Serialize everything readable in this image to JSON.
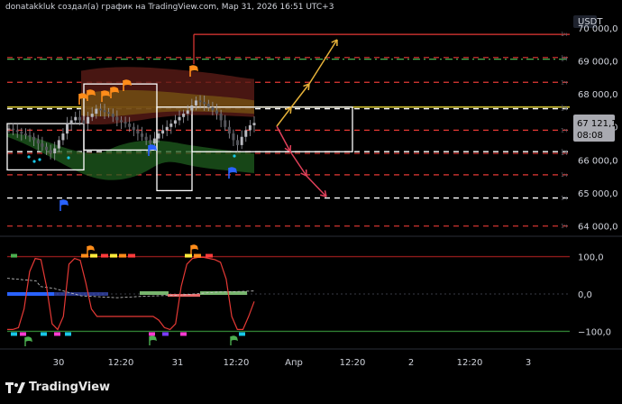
{
  "header": {
    "caption": "donatakkluk создал(а) график на TradingView.com, Мар 31, 2026 16:51 UTC+3"
  },
  "price_axis": {
    "currency": "USDT",
    "last_price": "67 121,1",
    "countdown": "08:08",
    "tick_labels": [
      "70 000,0",
      "69 000,0",
      "68 000,0",
      "67 000,0",
      "66 000,0",
      "65 000,0",
      "64 000,0"
    ],
    "line_tag": "1ч"
  },
  "oscillator_axis": {
    "tick_labels": [
      "100,0",
      "0,0",
      "−100,0"
    ]
  },
  "time_axis": {
    "tick_labels": [
      "30",
      "12:20",
      "31",
      "12:20",
      "Апр",
      "12:20",
      "2",
      "12:20",
      "3"
    ]
  },
  "footer": {
    "brand": "TradingView"
  },
  "colors": {
    "background": "#000000",
    "red_level": "#e53935",
    "green_level": "#4caf50",
    "yellow_level": "#ffeb3b",
    "white_level": "#ffffff",
    "projection_up": "#e6b23a",
    "projection_down": "#e0405a",
    "flag_orange": "#ff8c1a",
    "flag_blue": "#2962ff",
    "oscillator_line": "#e53935",
    "price_tag_bg": "#a9aab1"
  },
  "chart_data": {
    "type": "candlestick",
    "price_range": [
      63800,
      70350
    ],
    "levels": [
      {
        "price": 69800,
        "color": "red",
        "style": "solid"
      },
      {
        "price": 69100,
        "color": "red",
        "style": "dashed"
      },
      {
        "price": 69050,
        "color": "green",
        "style": "dashdot"
      },
      {
        "price": 68350,
        "color": "red",
        "style": "dashed"
      },
      {
        "price": 67600,
        "color": "yellow",
        "style": "solid"
      },
      {
        "price": 67550,
        "color": "white",
        "style": "dashed"
      },
      {
        "price": 66900,
        "color": "red",
        "style": "dashed"
      },
      {
        "price": 66250,
        "color": "white",
        "style": "dashed"
      },
      {
        "price": 66200,
        "color": "red",
        "style": "dashed"
      },
      {
        "price": 65550,
        "color": "red",
        "style": "dashed"
      },
      {
        "price": 64850,
        "color": "white",
        "style": "dashed"
      },
      {
        "price": 64000,
        "color": "red",
        "style": "dashed"
      }
    ],
    "zones": [
      {
        "price_top": 68300,
        "price_bottom": 66300,
        "start": "30 06:00",
        "end": "30 14:00"
      },
      {
        "price_top": 67600,
        "price_bottom": 66300,
        "start": "31 00:30",
        "end": "31 08:30"
      },
      {
        "price_top": 67600,
        "price_bottom": 66250,
        "start": "31 08:30",
        "end": "Апр 12:20"
      }
    ],
    "projections": [
      {
        "direction": "up",
        "path": [
          [
            67100,
            "31 17:00"
          ],
          [
            67600,
            "31 20:00"
          ],
          [
            68400,
            "Апр 01:00"
          ],
          [
            69800,
            "Апр 07:00"
          ]
        ]
      },
      {
        "direction": "down",
        "path": [
          [
            67100,
            "31 17:00"
          ],
          [
            66300,
            "31 20:00"
          ],
          [
            65500,
            "Апр 01:00"
          ],
          [
            64850,
            "Апр 04:00"
          ]
        ]
      }
    ],
    "close_series": [
      66950,
      66900,
      66850,
      66800,
      66750,
      66700,
      66600,
      66500,
      66400,
      66300,
      66200,
      66350,
      66600,
      66800,
      67100,
      67200,
      67300,
      67200,
      67100,
      67300,
      67400,
      67550,
      67500,
      67450,
      67400,
      67300,
      67200,
      67150,
      67100,
      67000,
      66900,
      66800,
      66700,
      66600,
      66500,
      66650,
      66800,
      66900,
      67000,
      67100,
      67200,
      67300,
      67400,
      67500,
      67650,
      67800,
      67750,
      67700,
      67600,
      67500,
      67400,
      67200,
      67000,
      66800,
      66600,
      66450,
      66700,
      66900,
      67050,
      67121
    ],
    "oscillator": {
      "range": [
        -140,
        140
      ],
      "levels": [
        100,
        0,
        -100
      ],
      "values": [
        -95,
        -95,
        -90,
        -40,
        60,
        95,
        92,
        20,
        -80,
        -95,
        -60,
        80,
        95,
        90,
        30,
        -40,
        -60,
        -60,
        -60,
        -60,
        -60,
        -60,
        -60,
        -60,
        -60,
        -60,
        -60,
        -70,
        -90,
        -95,
        -80,
        20,
        80,
        95,
        98,
        98,
        95,
        92,
        85,
        40,
        -60,
        -95,
        -95,
        -60,
        -20
      ]
    }
  }
}
